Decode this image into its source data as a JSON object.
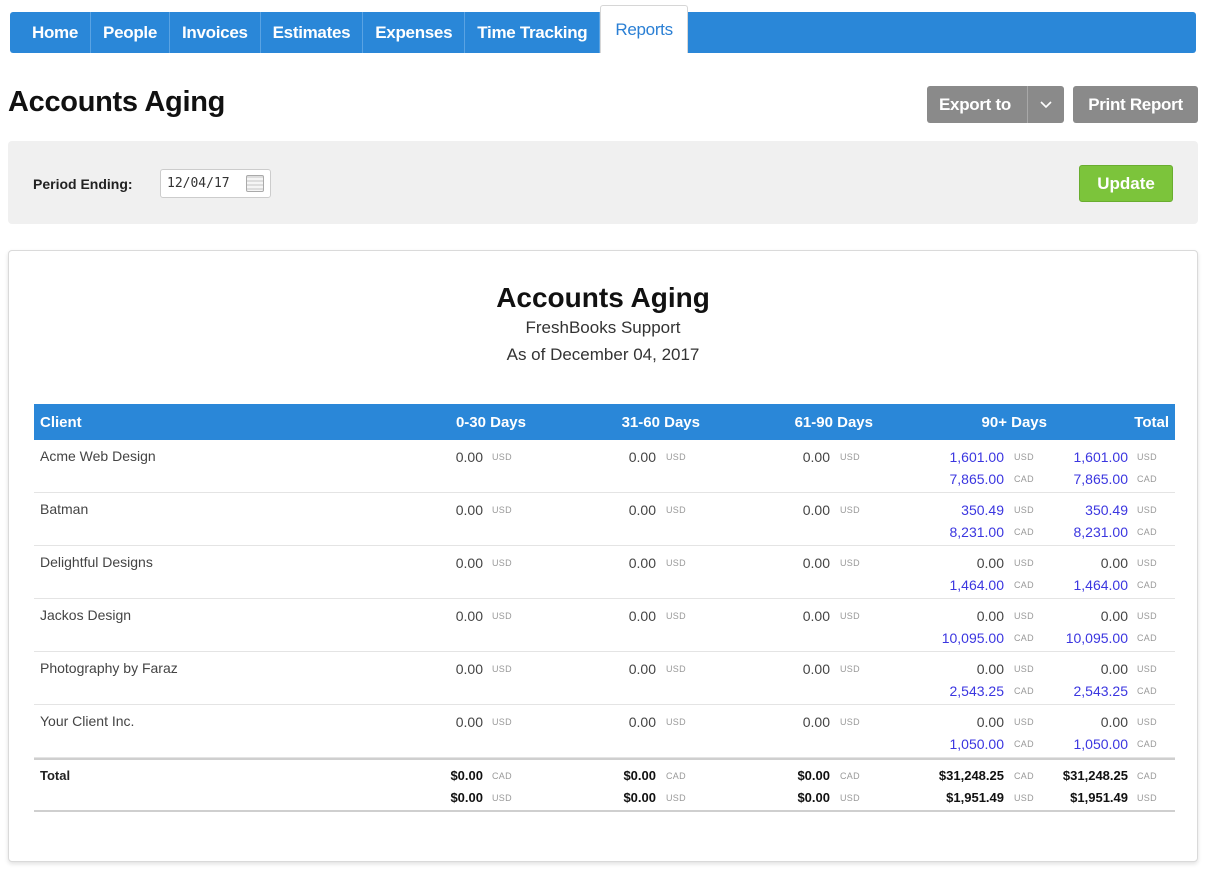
{
  "nav": {
    "tabs": [
      {
        "label": "Home",
        "active": false
      },
      {
        "label": "People",
        "active": false
      },
      {
        "label": "Invoices",
        "active": false
      },
      {
        "label": "Estimates",
        "active": false
      },
      {
        "label": "Expenses",
        "active": false
      },
      {
        "label": "Time Tracking",
        "active": false
      },
      {
        "label": "Reports",
        "active": true
      }
    ]
  },
  "header": {
    "title": "Accounts Aging",
    "export_label": "Export to",
    "export_icon": "chevron-down-icon",
    "print_label": "Print Report"
  },
  "filter": {
    "period_label": "Period Ending:",
    "period_value": "12/04/17",
    "calendar_icon": "calendar-icon",
    "update_label": "Update"
  },
  "report": {
    "title": "Accounts Aging",
    "company": "FreshBooks Support",
    "as_of": "As of December 04, 2017",
    "columns": [
      "Client",
      "0-30 Days",
      "31-60 Days",
      "61-90 Days",
      "90+ Days",
      "Total"
    ],
    "rows": [
      {
        "client": "Acme Web Design",
        "d0_30": "0.00",
        "d0_30_cur": "USD",
        "d31_60": "0.00",
        "d31_60_cur": "USD",
        "d61_90": "0.00",
        "d61_90_cur": "USD",
        "d90_1": "1,601.00",
        "d90_1_cur": "USD",
        "d90_2": "7,865.00",
        "d90_2_cur": "CAD",
        "tot_1": "1,601.00",
        "tot_1_cur": "USD",
        "tot_2": "7,865.00",
        "tot_2_cur": "CAD"
      },
      {
        "client": "Batman",
        "d0_30": "0.00",
        "d0_30_cur": "USD",
        "d31_60": "0.00",
        "d31_60_cur": "USD",
        "d61_90": "0.00",
        "d61_90_cur": "USD",
        "d90_1": "350.49",
        "d90_1_cur": "USD",
        "d90_2": "8,231.00",
        "d90_2_cur": "CAD",
        "tot_1": "350.49",
        "tot_1_cur": "USD",
        "tot_2": "8,231.00",
        "tot_2_cur": "CAD"
      },
      {
        "client": "Delightful Designs",
        "d0_30": "0.00",
        "d0_30_cur": "USD",
        "d31_60": "0.00",
        "d31_60_cur": "USD",
        "d61_90": "0.00",
        "d61_90_cur": "USD",
        "d90_1": "0.00",
        "d90_1_cur": "USD",
        "d90_2": "1,464.00",
        "d90_2_cur": "CAD",
        "tot_1": "0.00",
        "tot_1_cur": "USD",
        "tot_2": "1,464.00",
        "tot_2_cur": "CAD"
      },
      {
        "client": "Jackos Design",
        "d0_30": "0.00",
        "d0_30_cur": "USD",
        "d31_60": "0.00",
        "d31_60_cur": "USD",
        "d61_90": "0.00",
        "d61_90_cur": "USD",
        "d90_1": "0.00",
        "d90_1_cur": "USD",
        "d90_2": "10,095.00",
        "d90_2_cur": "CAD",
        "tot_1": "0.00",
        "tot_1_cur": "USD",
        "tot_2": "10,095.00",
        "tot_2_cur": "CAD"
      },
      {
        "client": "Photography by Faraz",
        "d0_30": "0.00",
        "d0_30_cur": "USD",
        "d31_60": "0.00",
        "d31_60_cur": "USD",
        "d61_90": "0.00",
        "d61_90_cur": "USD",
        "d90_1": "0.00",
        "d90_1_cur": "USD",
        "d90_2": "2,543.25",
        "d90_2_cur": "CAD",
        "tot_1": "0.00",
        "tot_1_cur": "USD",
        "tot_2": "2,543.25",
        "tot_2_cur": "CAD"
      },
      {
        "client": "Your Client Inc.",
        "d0_30": "0.00",
        "d0_30_cur": "USD",
        "d31_60": "0.00",
        "d31_60_cur": "USD",
        "d61_90": "0.00",
        "d61_90_cur": "USD",
        "d90_1": "0.00",
        "d90_1_cur": "USD",
        "d90_2": "1,050.00",
        "d90_2_cur": "CAD",
        "tot_1": "0.00",
        "tot_1_cur": "USD",
        "tot_2": "1,050.00",
        "tot_2_cur": "CAD"
      }
    ],
    "totals": {
      "label": "Total",
      "d0_30": [
        "$0.00",
        "$0.00"
      ],
      "d0_30_cur": [
        "CAD",
        "USD"
      ],
      "d31_60": [
        "$0.00",
        "$0.00"
      ],
      "d31_60_cur": [
        "CAD",
        "USD"
      ],
      "d61_90": [
        "$0.00",
        "$0.00"
      ],
      "d61_90_cur": [
        "CAD",
        "USD"
      ],
      "d90": [
        "$31,248.25",
        "$1,951.49"
      ],
      "d90_cur": [
        "CAD",
        "USD"
      ],
      "tot": [
        "$31,248.25",
        "$1,951.49"
      ],
      "tot_cur": [
        "CAD",
        "USD"
      ]
    }
  },
  "colors": {
    "nav_blue": "#2a87d8",
    "update_green": "#7cc43b",
    "link_blue": "#3b36e0",
    "button_gray": "#8a8a8a"
  }
}
